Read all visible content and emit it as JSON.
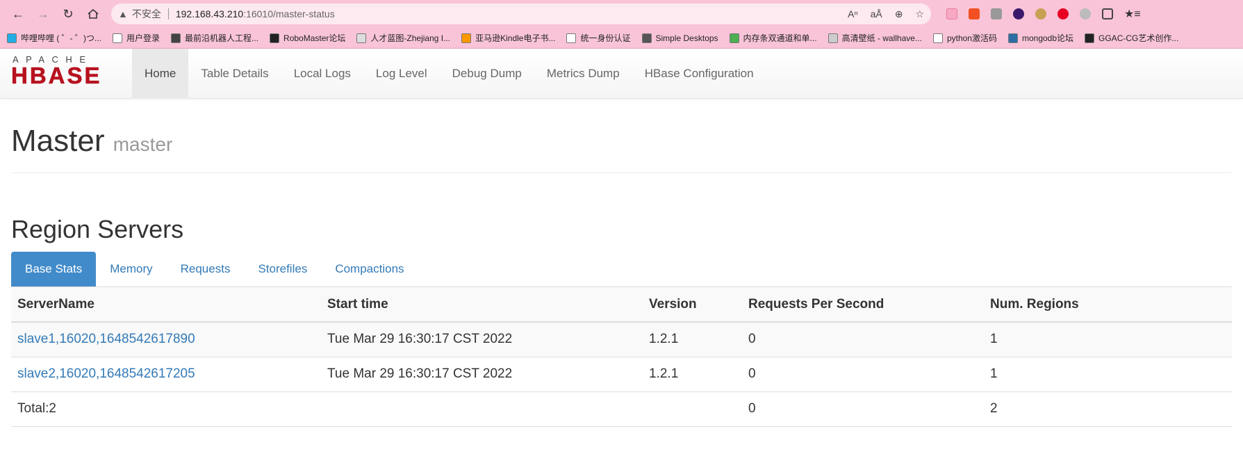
{
  "browser": {
    "insecure_label": "不安全",
    "url_host": "192.168.43.210",
    "url_path": ":16010/master-status",
    "bookmarks": [
      {
        "label": "哔哩哔哩 ( ゜- ゜)つ...",
        "color": "#23ade5"
      },
      {
        "label": "用户登录",
        "color": "#ffffff"
      },
      {
        "label": "最前沿机器人工程...",
        "color": "#444444"
      },
      {
        "label": "RoboMaster论坛",
        "color": "#222222"
      },
      {
        "label": "人才蓝图-Zhejiang I...",
        "color": "#dddddd"
      },
      {
        "label": "亚马逊Kindle电子书...",
        "color": "#ff9900"
      },
      {
        "label": "统一身份认证",
        "color": "#ffffff"
      },
      {
        "label": "Simple Desktops",
        "color": "#555555"
      },
      {
        "label": "内存条双通道和单...",
        "color": "#4caf50"
      },
      {
        "label": "高清壁纸 - wallhave...",
        "color": "#cccccc"
      },
      {
        "label": "python激活码",
        "color": "#ffffff"
      },
      {
        "label": "mongodb论坛",
        "color": "#2e6da4"
      },
      {
        "label": "GGAC-CG艺术创作...",
        "color": "#222222"
      }
    ]
  },
  "navbar": {
    "logo_top": "APACHE",
    "logo_bottom": "HBASE",
    "items": [
      {
        "label": "Home",
        "active": true
      },
      {
        "label": "Table Details"
      },
      {
        "label": "Local Logs"
      },
      {
        "label": "Log Level"
      },
      {
        "label": "Debug Dump"
      },
      {
        "label": "Metrics Dump"
      },
      {
        "label": "HBase Configuration"
      }
    ]
  },
  "header": {
    "title": "Master",
    "subtitle": "master"
  },
  "region_servers": {
    "title": "Region Servers",
    "tabs": [
      "Base Stats",
      "Memory",
      "Requests",
      "Storefiles",
      "Compactions"
    ],
    "columns": [
      "ServerName",
      "Start time",
      "Version",
      "Requests Per Second",
      "Num. Regions"
    ],
    "rows": [
      {
        "server": "slave1,16020,1648542617890",
        "start": "Tue Mar 29 16:30:17 CST 2022",
        "version": "1.2.1",
        "rps": "0",
        "regions": "1"
      },
      {
        "server": "slave2,16020,1648542617205",
        "start": "Tue Mar 29 16:30:17 CST 2022",
        "version": "1.2.1",
        "rps": "0",
        "regions": "1"
      }
    ],
    "total": {
      "label": "Total:2",
      "rps": "0",
      "regions": "2"
    }
  },
  "colors": {
    "accent": "#428bca",
    "link": "#337ab7",
    "logo_red": "#b7121f",
    "browser_pink": "#f9c4d8"
  }
}
